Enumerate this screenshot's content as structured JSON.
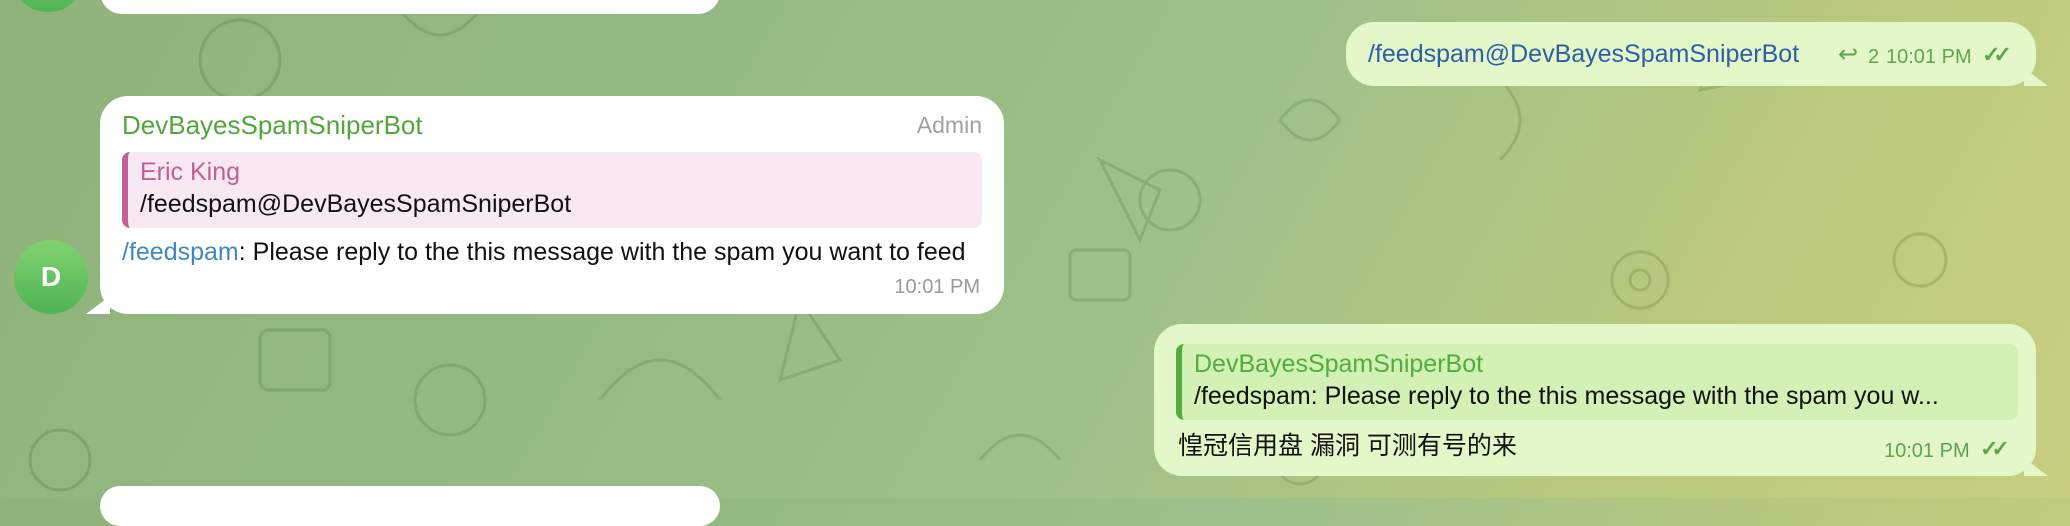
{
  "avatar_letter": "D",
  "message_bot": {
    "sender": "DevBayesSpamSniperBot",
    "role": "Admin",
    "reply_to_name": "Eric King",
    "reply_to_text": "/feedspam@DevBayesSpamSniperBot",
    "command": "/feedspam",
    "text": ": Please reply to the this message with the spam you want to feed",
    "time": "10:01 PM"
  },
  "message_out_command": {
    "text": "/feedspam@DevBayesSpamSniperBot",
    "reply_count": "2",
    "time": "10:01 PM",
    "status": "read-double-check"
  },
  "message_out_spam": {
    "reply_to_name": "DevBayesSpamSniperBot",
    "reply_to_text": "/feedspam: Please reply to the this message with the spam you w...",
    "text": "惶冠信用盘 漏洞 可测有号的来",
    "time": "10:01 PM",
    "status": "read-double-check"
  },
  "icons": {
    "reply": "reply-arrow-icon",
    "read": "double-check-icon"
  },
  "colors": {
    "sender_green": "#53a73a",
    "quote_pink": "#c45e97",
    "command_blue": "#3e88c4",
    "outgoing_bubble": "#e3f7c8"
  }
}
